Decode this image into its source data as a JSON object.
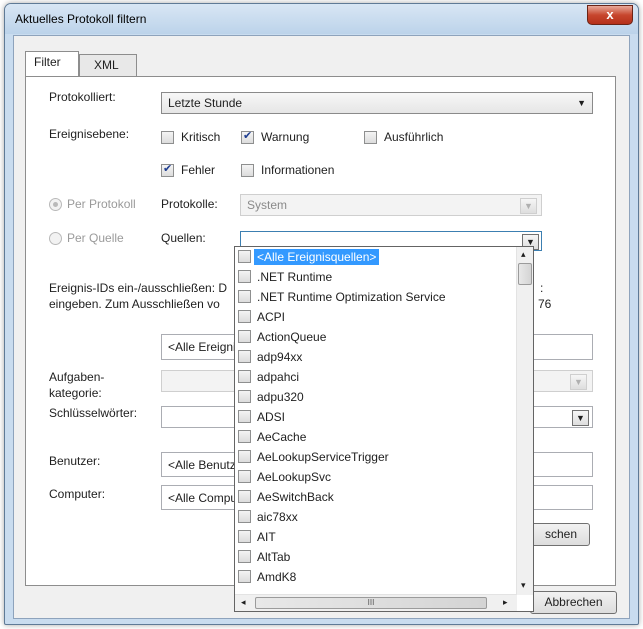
{
  "window": {
    "title": "Aktuelles Protokoll filtern",
    "close_glyph": "x"
  },
  "tabs": [
    {
      "label": "Filter"
    },
    {
      "label": "XML"
    }
  ],
  "filter": {
    "logged_label": "Protokolliert:",
    "logged_value": "Letzte Stunde",
    "event_level_label": "Ereignisebene:",
    "levels": {
      "critical": {
        "label": "Kritisch",
        "checked": false
      },
      "warning": {
        "label": "Warnung",
        "checked": true
      },
      "verbose": {
        "label": "Ausführlich",
        "checked": false
      },
      "error": {
        "label": "Fehler",
        "checked": true
      },
      "information": {
        "label": "Informationen",
        "checked": false
      }
    },
    "by_log_label": "Per Protokoll",
    "logs_label": "Protokolle:",
    "logs_value": "System",
    "by_source_label": "Per Quelle",
    "sources_label": "Quellen:",
    "sources_value": "",
    "event_ids_text_line1": "Ereignis-IDs ein-/ausschließen: D",
    "event_ids_text_line2": "eingeben. Zum Ausschließen vo",
    "event_ids_text_tail1": ":",
    "event_ids_text_tail2": "76",
    "event_ids_value": "<Alle Ereigni",
    "task_category_label_line1": "Aufgaben-",
    "task_category_label_line2": "kategorie:",
    "keywords_label": "Schlüsselwörter:",
    "user_label": "Benutzer:",
    "user_value": "<Alle Benutz",
    "computer_label": "Computer:",
    "computer_value": "<Alle Compu",
    "clear_button_partial": "schen",
    "cancel_button": "Abbrechen"
  },
  "sources_list": {
    "items": [
      "<Alle Ereignisquellen>",
      ".NET Runtime",
      ".NET Runtime Optimization Service",
      "ACPI",
      "ActionQueue",
      "adp94xx",
      "adpahci",
      "adpu320",
      "ADSI",
      "AeCache",
      "AeLookupServiceTrigger",
      "AeLookupSvc",
      "AeSwitchBack",
      "aic78xx",
      "AIT",
      "AltTab",
      "AmdK8"
    ],
    "highlighted_index": 0,
    "scroll_left_glyph": "◂",
    "scroll_right_glyph": "▸",
    "scroll_up_glyph": "▴",
    "scroll_down_glyph": "▾",
    "grip_glyph": "III"
  },
  "colors": {
    "highlight": "#3399ff",
    "frame": "#c9dcef",
    "close": "#c7462e"
  }
}
